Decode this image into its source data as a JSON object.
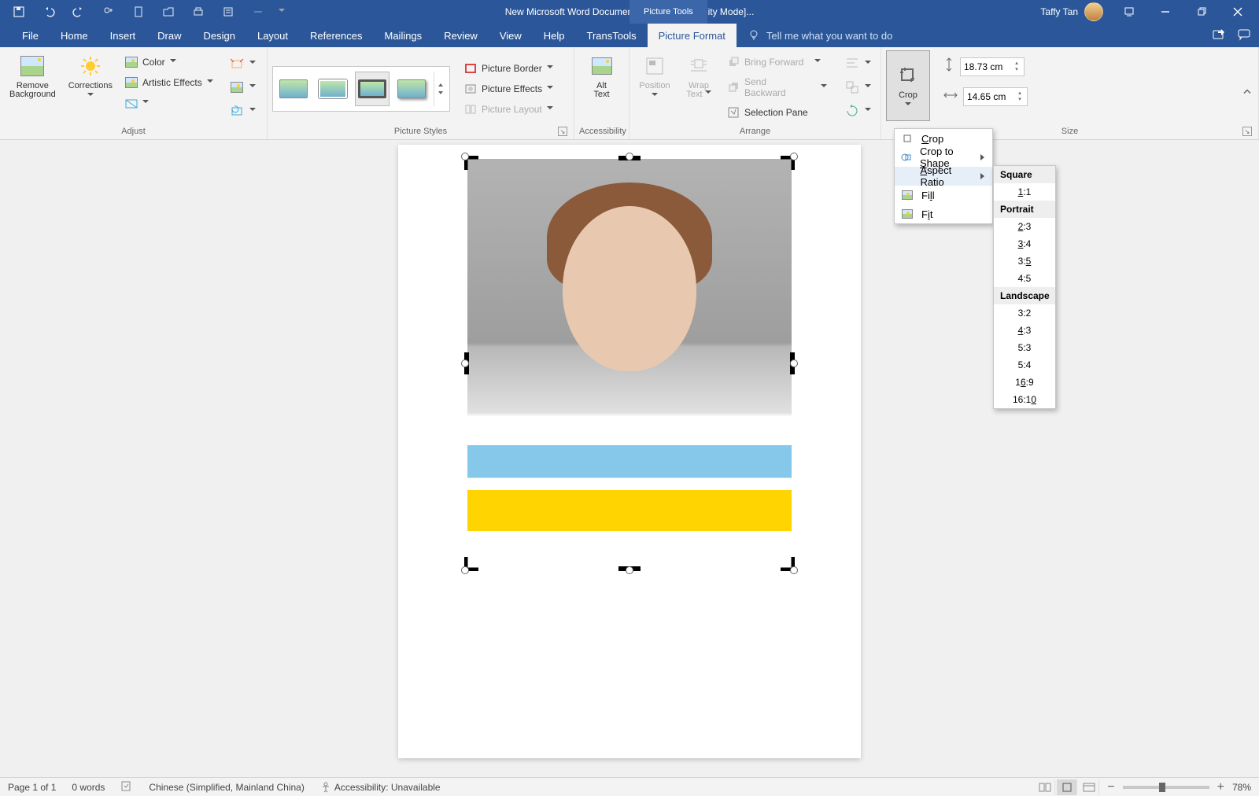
{
  "titlebar": {
    "doc_title": "New Microsoft Word Document.docx [Compatibility Mode]...",
    "tool_tab": "Picture Tools",
    "user_name": "Taffy Tan"
  },
  "tabs": {
    "file": "File",
    "home": "Home",
    "insert": "Insert",
    "draw": "Draw",
    "design": "Design",
    "layout": "Layout",
    "references": "References",
    "mailings": "Mailings",
    "review": "Review",
    "view": "View",
    "help": "Help",
    "transtools": "TransTools",
    "picture_format": "Picture Format",
    "tell_me": "Tell me what you want to do"
  },
  "ribbon": {
    "remove_bg_l1": "Remove",
    "remove_bg_l2": "Background",
    "corrections": "Corrections",
    "color": "Color",
    "artistic": "Artistic Effects",
    "adjust_label": "Adjust",
    "picture_styles_label": "Picture Styles",
    "picture_border": "Picture Border",
    "picture_effects": "Picture Effects",
    "picture_layout": "Picture Layout",
    "alt_text_l1": "Alt",
    "alt_text_l2": "Text",
    "accessibility_label": "Accessibility",
    "position": "Position",
    "wrap_text_l1": "Wrap",
    "wrap_text_l2": "Text",
    "bring_forward": "Bring Forward",
    "send_backward": "Send Backward",
    "selection_pane": "Selection Pane",
    "arrange_label": "Arrange",
    "crop": "Crop",
    "height": "18.73 cm",
    "width": "14.65 cm",
    "size_label": "Size"
  },
  "crop_menu": {
    "crop": "Crop",
    "crop_to_shape": "Crop to Shape",
    "aspect_ratio": "Aspect Ratio",
    "fill": "Fill",
    "fit": "Fit"
  },
  "ratio_menu": {
    "square_hdr": "Square",
    "r11": "1:1",
    "portrait_hdr": "Portrait",
    "r23": "2:3",
    "r34": "3:4",
    "r35": "3:5",
    "r45": "4:5",
    "landscape_hdr": "Landscape",
    "r32": "3:2",
    "r43": "4:3",
    "r53": "5:3",
    "r54": "5:4",
    "r169": "16:9",
    "r1610": "16:10"
  },
  "status": {
    "page": "Page 1 of 1",
    "words": "0 words",
    "lang": "Chinese (Simplified, Mainland China)",
    "accessibility": "Accessibility: Unavailable",
    "zoom": "78%"
  }
}
